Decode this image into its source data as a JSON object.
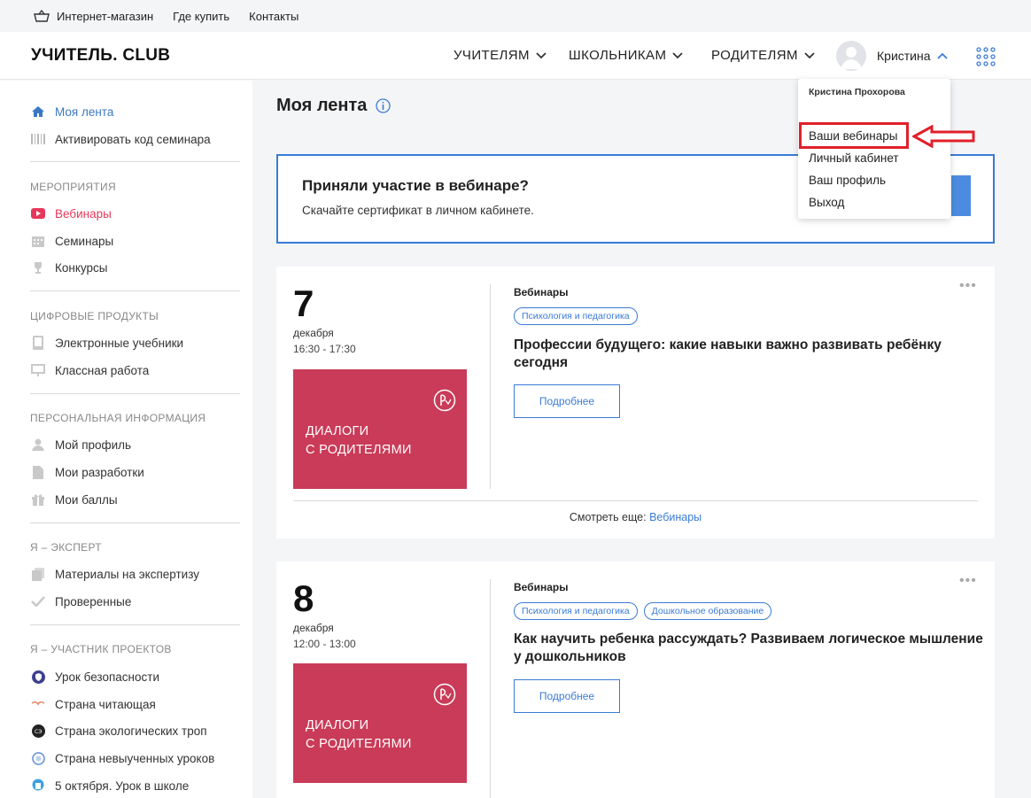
{
  "topbar": {
    "items": [
      {
        "label": "Интернет-магазин",
        "icon": "basket-icon"
      },
      {
        "label": "Где купить"
      },
      {
        "label": "Контакты"
      }
    ]
  },
  "header": {
    "logo": "УЧИТЕЛЬ. CLUB",
    "nav": [
      "УЧИТЕЛЯМ",
      "ШКОЛЬНИКАМ",
      "РОДИТЕЛЯМ"
    ],
    "user_name": "Кристина"
  },
  "sidebar": {
    "top_items": [
      {
        "label": "Моя лента",
        "icon": "home-icon"
      },
      {
        "label": "Активировать код семинара",
        "icon": "barcode-icon"
      }
    ],
    "sections": [
      {
        "title": "МЕРОПРИЯТИЯ",
        "items": [
          {
            "label": "Вебинары",
            "icon": "video-icon"
          },
          {
            "label": "Семинары",
            "icon": "calendar-icon"
          },
          {
            "label": "Конкурсы",
            "icon": "trophy-icon"
          }
        ]
      },
      {
        "title": "ЦИФРОВЫЕ ПРОДУКТЫ",
        "items": [
          {
            "label": "Электронные учебники",
            "icon": "tablet-icon"
          },
          {
            "label": "Классная работа",
            "icon": "board-icon"
          }
        ]
      },
      {
        "title": "ПЕРСОНАЛЬНАЯ ИНФОРМАЦИЯ",
        "items": [
          {
            "label": "Мой профиль",
            "icon": "user-icon"
          },
          {
            "label": "Мои разработки",
            "icon": "document-icon"
          },
          {
            "label": "Мои баллы",
            "icon": "gift-icon"
          }
        ]
      },
      {
        "title": "Я – ЭКСПЕРТ",
        "items": [
          {
            "label": "Материалы на экспертизу",
            "icon": "copy-icon"
          },
          {
            "label": "Проверенные",
            "icon": "check-icon"
          }
        ]
      },
      {
        "title": "Я – УЧАСТНИК ПРОЕКТОВ",
        "items": [
          {
            "label": "Урок безопасности",
            "icon": "shield-icon"
          },
          {
            "label": "Страна читающая",
            "icon": "book-icon"
          },
          {
            "label": "Страна экологических троп",
            "icon": "eco-icon"
          },
          {
            "label": "Страна невыученных уроков",
            "icon": "globe-icon"
          },
          {
            "label": "5 октября. Урок в школе",
            "icon": "school-icon"
          }
        ]
      }
    ]
  },
  "main": {
    "title": "Моя лента",
    "banner": {
      "title": "Приняли участие в вебинаре?",
      "text": "Скачайте сертификат в личном кабинете."
    },
    "cards": [
      {
        "day": "7",
        "month": "декабря",
        "time": "16:30 - 17:30",
        "poster_text": [
          "ДИАЛОГИ",
          "С РОДИТЕЛЯМИ"
        ],
        "category": "Вебинары",
        "tags": [
          "Психология и педагогика"
        ],
        "title": "Профессии будущего: какие навыки важно развивать ребёнку сегодня",
        "button": "Подробнее",
        "see_more_prefix": "Смотреть еще:",
        "see_more_link": "Вебинары"
      },
      {
        "day": "8",
        "month": "декабря",
        "time": "12:00 - 13:00",
        "poster_text": [
          "ДИАЛОГИ",
          "С РОДИТЕЛЯМИ"
        ],
        "category": "Вебинары",
        "tags": [
          "Психология и педагогика",
          "Дошкольное образование"
        ],
        "title": "Как научить ребенка рассуждать? Развиваем логическое мышление у дошкольников",
        "button": "Подробнее"
      }
    ]
  },
  "dropdown": {
    "full_name": "Кристина Прохорова",
    "items": [
      "Ваши вебинары",
      "Личный кабинет",
      "Ваш профиль",
      "Выход"
    ]
  },
  "colors": {
    "accent": "#3a7bd5",
    "poster": "#c93b58",
    "highlight": "#e0202a",
    "webinar_red": "#e6385a"
  }
}
